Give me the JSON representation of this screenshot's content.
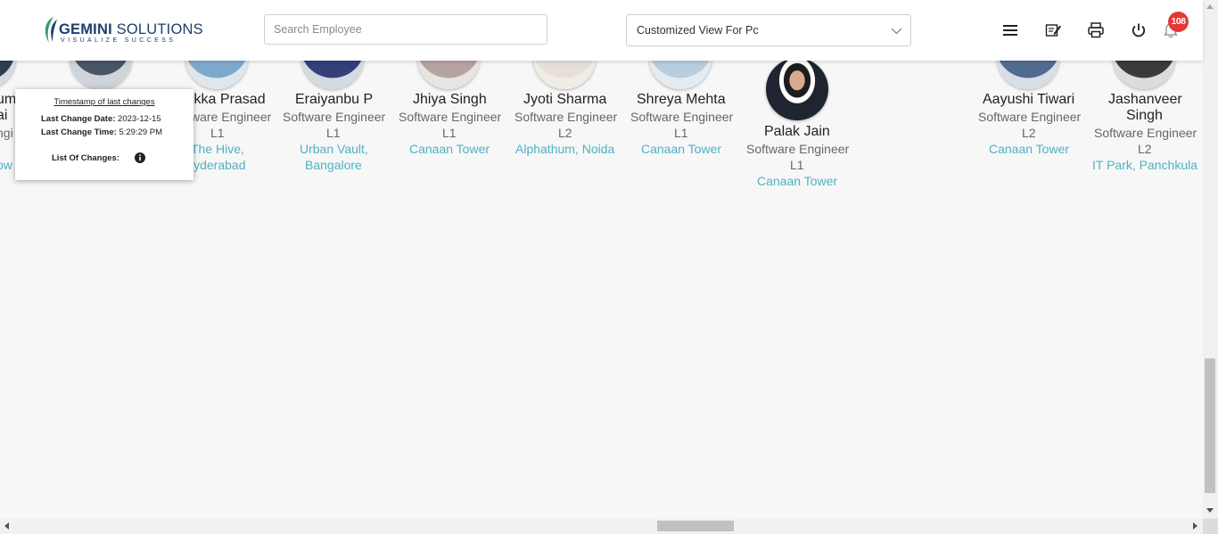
{
  "header": {
    "logo_name_bold": "GEMINI",
    "logo_name_rest": " SOLUTIONS",
    "logo_tagline": "VISUALIZE SUCCESS",
    "search_placeholder": "Search Employee",
    "view_selected": "Customized View For Pc",
    "notification_count": "108",
    "icons": [
      "menu-icon",
      "edit-note-icon",
      "print-icon",
      "power-icon",
      "bell-icon"
    ]
  },
  "tooltip": {
    "title": "Timestamp of last changes",
    "date_label": "Last Change Date:",
    "date_value": "2023-12-15",
    "time_label": "Last Change Time:",
    "time_value": "5:29:29 PM",
    "changes_label": "List Of Changes:"
  },
  "employees": [
    {
      "name1": "um",
      "name2": "ai",
      "role": "ngi",
      "loc1": "ow"
    },
    {
      "name1": "ikka Prasad",
      "role": "ware Engineer",
      "level": "L1",
      "loc1": "The Hive,",
      "loc2": "lyderabad"
    },
    {
      "name1": "Eraiyanbu P",
      "role": "Software Engineer",
      "level": "L1",
      "loc1": "Urban Vault,",
      "loc2": "Bangalore"
    },
    {
      "name1": "Jhiya Singh",
      "role": "Software Engineer",
      "level": "L1",
      "loc1": "Canaan Tower"
    },
    {
      "name1": "Jyoti Sharma",
      "role": "Software Engineer",
      "level": "L2",
      "loc1": "Alphathum, Noida"
    },
    {
      "name1": "Shreya Mehta",
      "role": "Software Engineer",
      "level": "L1",
      "loc1": "Canaan Tower"
    },
    {
      "name1": "Palak Jain",
      "role": "Software Engineer",
      "level": "L1",
      "loc1": "Canaan Tower"
    },
    {
      "name1": "Aayushi Tiwari",
      "role": "Software Engineer",
      "level": "L2",
      "loc1": "Canaan Tower"
    },
    {
      "name1": "Jashanveer",
      "name2": "Singh",
      "role": "Software Engineer",
      "level": "L2",
      "loc1": "IT Park, Panchkula"
    }
  ],
  "colors": {
    "accent_link": "#4cb3c4",
    "badge": "#e53935",
    "logo_blue": "#1c3f6e",
    "logo_green": "#2a9d6e"
  }
}
